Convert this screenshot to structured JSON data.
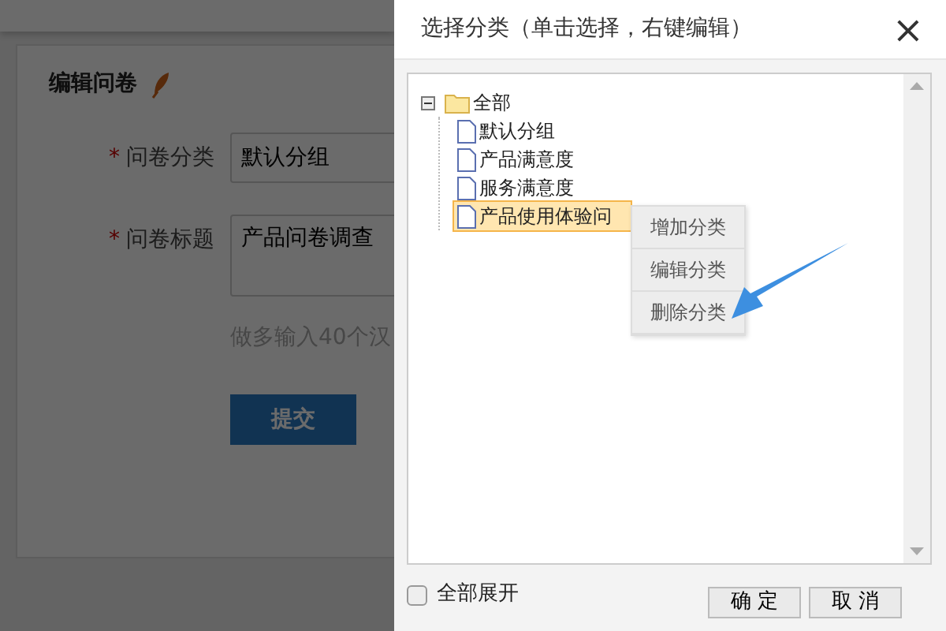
{
  "page": {
    "title": "编辑问卷",
    "fields": [
      {
        "kind": "input",
        "label": "问卷分类",
        "required": true,
        "value": "默认分组"
      },
      {
        "kind": "textarea",
        "label": "问卷标题",
        "required": true,
        "value": "产品问卷调查"
      }
    ],
    "required_mark": "*",
    "hint": "做多输入40个汉",
    "submit": "提交"
  },
  "dialog": {
    "title": "选择分类（单击选择，右键编辑）",
    "close": "×",
    "tree": [
      {
        "label": "全部",
        "kind": "folder",
        "expanded": true,
        "selected": false,
        "children": [
          {
            "label": "默认分组",
            "kind": "file",
            "selected": false
          },
          {
            "label": "产品满意度",
            "kind": "file",
            "selected": false
          },
          {
            "label": "服务满意度",
            "kind": "file",
            "selected": false
          },
          {
            "label": "产品使用体验问",
            "kind": "file",
            "selected": true
          }
        ]
      }
    ],
    "context_menu": [
      "增加分类",
      "编辑分类",
      "删除分类"
    ],
    "expand_all": {
      "label": "全部展开",
      "checked": false
    },
    "buttons": [
      "确 定",
      "取 消"
    ]
  }
}
